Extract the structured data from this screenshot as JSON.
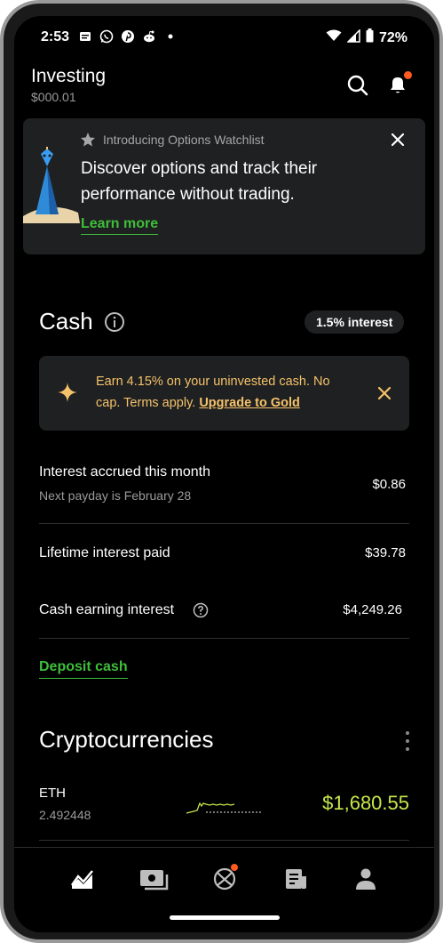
{
  "status_bar": {
    "time": "2:53",
    "battery": "72%"
  },
  "header": {
    "title": "Investing",
    "balance": "$000.01"
  },
  "banner": {
    "intro": "Introducing Options Watchlist",
    "headline": "Discover options and track their performance without trading.",
    "link": "Learn more"
  },
  "cash": {
    "title": "Cash",
    "interest_pill": "1.5% interest",
    "gold_text": "Earn 4.15% on your uninvested cash. No cap. Terms apply.",
    "gold_link": "Upgrade to Gold",
    "rows": [
      {
        "label": "Interest accrued this month",
        "sub": "Next payday is February 28",
        "value": "$0.86"
      },
      {
        "label": "Lifetime interest paid",
        "value": "$39.78"
      },
      {
        "label": "Cash earning interest",
        "value": "$4,249.26"
      }
    ],
    "deposit": "Deposit cash"
  },
  "crypto": {
    "title": "Cryptocurrencies",
    "items": [
      {
        "symbol": "ETH",
        "quantity": "2.492448",
        "price": "$1,680.55"
      }
    ]
  },
  "colors": {
    "accent_green": "#3fbe3a",
    "gold": "#f5c26b",
    "price_green": "#c6e84a",
    "notification": "#ff5a1f"
  },
  "nav": [
    "investing-tab",
    "cards-tab",
    "crypto-tab",
    "news-tab",
    "account-tab"
  ]
}
